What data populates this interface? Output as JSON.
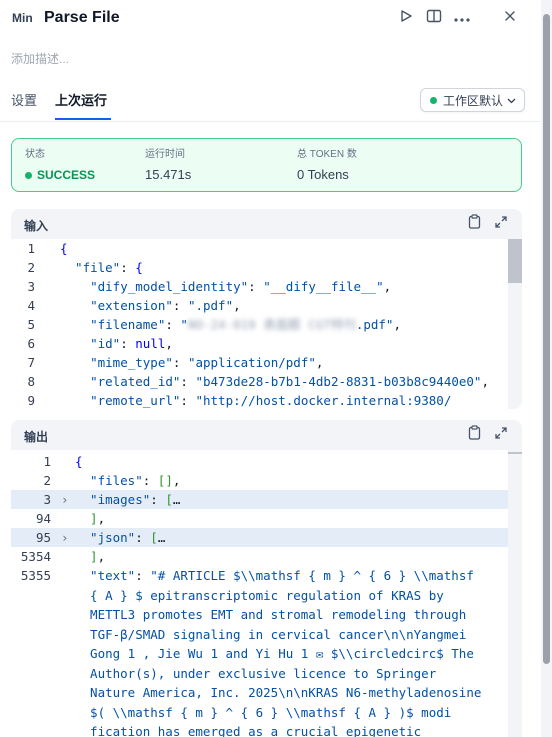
{
  "header": {
    "node_icon_label": "Min",
    "title": "Parse File",
    "description_placeholder": "添加描述..."
  },
  "tabs": [
    {
      "label": "设置"
    },
    {
      "label": "上次运行"
    }
  ],
  "workspace_button": {
    "label": "工作区默认"
  },
  "status": {
    "status_label": "状态",
    "status_value": "SUCCESS",
    "runtime_label": "运行时间",
    "runtime_value": "15.471s",
    "tokens_label": "总 TOKEN 数",
    "tokens_value": "0 Tokens"
  },
  "input": {
    "title": "输入",
    "lines": [
      {
        "n": "1",
        "parts": [
          [
            "br",
            "{"
          ]
        ]
      },
      {
        "n": "2",
        "parts": [
          [
            "key",
            "  \"file\""
          ],
          [
            "",
            ": "
          ],
          [
            "br",
            "{"
          ]
        ]
      },
      {
        "n": "3",
        "parts": [
          [
            "key",
            "    \"dify_model_identity\""
          ],
          [
            "",
            ": "
          ],
          [
            "str",
            "\"__dify__file__\""
          ],
          [
            "",
            ","
          ]
        ]
      },
      {
        "n": "4",
        "parts": [
          [
            "key",
            "    \"extension\""
          ],
          [
            "",
            ": "
          ],
          [
            "str",
            "\".pdf\""
          ],
          [
            "",
            ","
          ]
        ]
      },
      {
        "n": "5",
        "parts": [
          [
            "key",
            "    \"filename\""
          ],
          [
            "",
            ": "
          ],
          [
            "str",
            "\""
          ],
          [
            "blur",
            "NO-24-019 表面醛 CGT特刊"
          ],
          [
            "str",
            ".pdf\""
          ],
          [
            "",
            ","
          ]
        ]
      },
      {
        "n": "6",
        "parts": [
          [
            "key",
            "    \"id\""
          ],
          [
            "",
            ": "
          ],
          [
            "kw",
            "null"
          ],
          [
            "",
            ","
          ]
        ]
      },
      {
        "n": "7",
        "parts": [
          [
            "key",
            "    \"mime_type\""
          ],
          [
            "",
            ": "
          ],
          [
            "str",
            "\"application/pdf\""
          ],
          [
            "",
            ","
          ]
        ]
      },
      {
        "n": "8",
        "parts": [
          [
            "key",
            "    \"related_id\""
          ],
          [
            "",
            ": "
          ],
          [
            "str",
            "\"b473de28-b7b1-4db2-8831-b03b8c9440e0\""
          ],
          [
            "",
            ","
          ]
        ]
      },
      {
        "n": "9",
        "parts": [
          [
            "key",
            "    \"remote_url\""
          ],
          [
            "",
            ": "
          ],
          [
            "str",
            "\"http://host.docker.internal:9380/"
          ]
        ]
      }
    ]
  },
  "output": {
    "title": "输出",
    "lines": [
      {
        "n": "1",
        "fold": "",
        "hl": false,
        "parts": [
          [
            "br",
            "{"
          ]
        ]
      },
      {
        "n": "2",
        "fold": "",
        "hl": false,
        "parts": [
          [
            "key",
            "  \"files\""
          ],
          [
            "",
            ": "
          ],
          [
            "brg",
            "[]"
          ],
          [
            "",
            ","
          ]
        ]
      },
      {
        "n": "3",
        "fold": "›",
        "hl": true,
        "parts": [
          [
            "key",
            "  \"images\""
          ],
          [
            "",
            ": "
          ],
          [
            "brg",
            "["
          ],
          [
            "",
            "…"
          ]
        ]
      },
      {
        "n": "94",
        "fold": "",
        "hl": false,
        "parts": [
          [
            "brg",
            "  ]"
          ],
          [
            "",
            ","
          ]
        ]
      },
      {
        "n": "95",
        "fold": "›",
        "hl": true,
        "parts": [
          [
            "key",
            "  \"json\""
          ],
          [
            "",
            ": "
          ],
          [
            "brg",
            "["
          ],
          [
            "",
            "…"
          ]
        ]
      },
      {
        "n": "5354",
        "fold": "",
        "hl": false,
        "parts": [
          [
            "brg",
            "  ]"
          ],
          [
            "",
            ","
          ]
        ]
      }
    ],
    "text_line_number": "5355",
    "text_key": "\"text\"",
    "text_lines": [
      "\"# ARTICLE $\\\\mathsf { m } ^ { 6 } \\\\mathsf",
      "{ A } $ epitranscriptomic regulation of KRAS by",
      "METTL3 promotes EMT and stromal remodeling through",
      "TGF-β/SMAD signaling in cervical cancer\\n\\nYangmei",
      "Gong 1 , Jie Wu 1 and Yi Hu 1 ✉ $\\\\circledcirc$ The",
      "Author(s), under exclusive licence to Springer",
      "Nature America, Inc. 2025\\n\\nKRAS N6-methyladenosine",
      "$( \\\\mathsf { m } ^ { 6 } \\\\mathsf { A } )$ modi",
      "fication has emerged as a crucial epigenetic"
    ]
  }
}
